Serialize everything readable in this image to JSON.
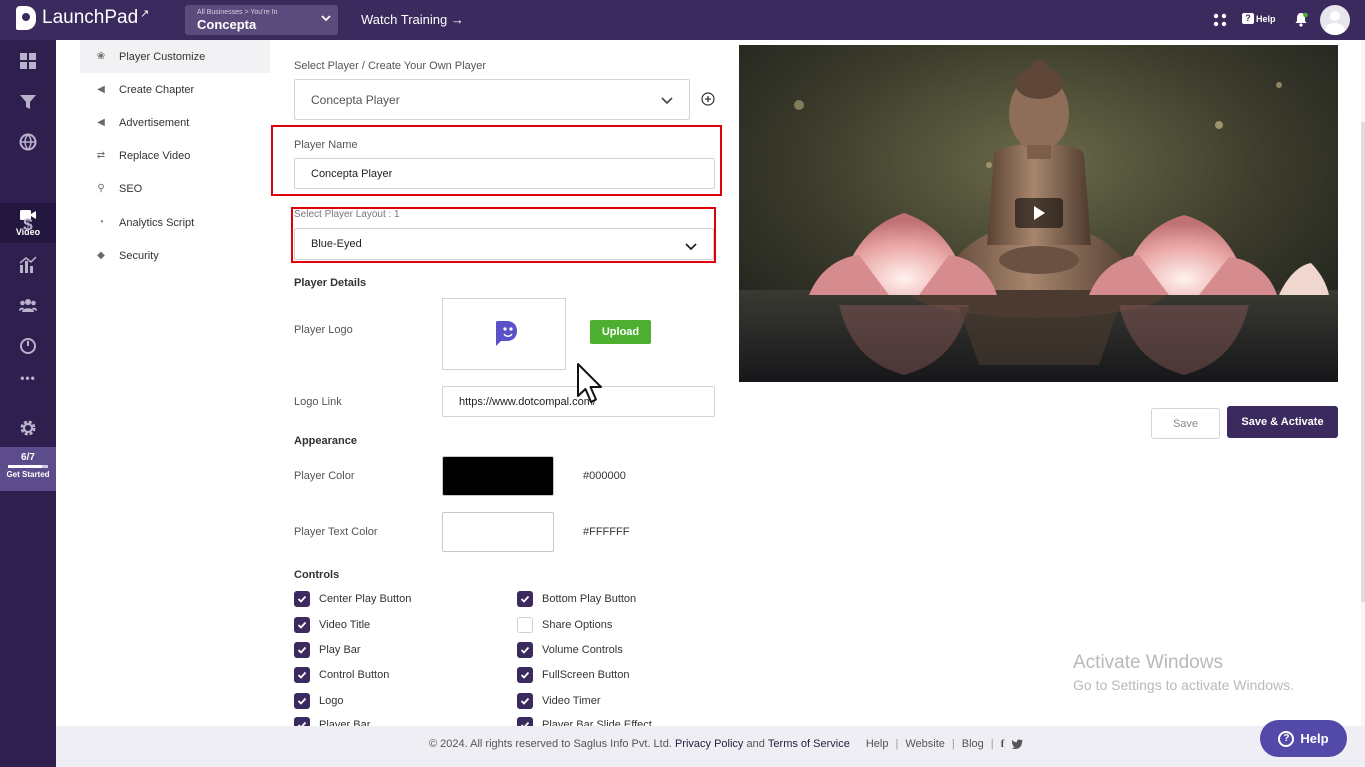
{
  "topbar": {
    "brand": "LaunchPad",
    "business_caption": "All Businesses > You're In",
    "business_name": "Concepta",
    "watch_training": "Watch Training →",
    "help_label": "Help",
    "help_glyph": "?",
    "bg_color": "#3b2a5e"
  },
  "rail": {
    "active_label": "Video",
    "progress_count": "6/7",
    "progress_fraction": 0.857,
    "get_started": "Get Started",
    "more_glyph": "•••"
  },
  "submenu": {
    "items": [
      {
        "label": "Player Customize",
        "icon": "palette-icon"
      },
      {
        "label": "Create Chapter",
        "icon": "megaphone-icon"
      },
      {
        "label": "Advertisement",
        "icon": "megaphone-icon"
      },
      {
        "label": "Replace Video",
        "icon": "swap-icon"
      },
      {
        "label": "SEO",
        "icon": "search-icon"
      },
      {
        "label": "Analytics Script",
        "icon": "chart-icon"
      },
      {
        "label": "Security",
        "icon": "shield-icon"
      }
    ]
  },
  "form": {
    "select_player_label": "Select Player / Create Your Own Player",
    "select_player_value": "Concepta Player",
    "player_name_label": "Player Name",
    "player_name_value": "Concepta Player",
    "layout_label": "Select Player Layout : 1",
    "layout_value": "Blue-Eyed",
    "player_details": "Player Details",
    "player_logo_label": "Player Logo",
    "upload_label": "Upload",
    "logo_link_label": "Logo Link",
    "logo_link_value": "https://www.dotcompal.com/",
    "appearance": "Appearance",
    "player_color_label": "Player Color",
    "player_color_value": "#000000",
    "player_text_color_label": "Player Text Color",
    "player_text_color_value": "#FFFFFF",
    "controls_label": "Controls",
    "controls_left": [
      {
        "label": "Center Play Button",
        "checked": true
      },
      {
        "label": "Video Title",
        "checked": true
      },
      {
        "label": "Play Bar",
        "checked": true
      },
      {
        "label": "Control Button",
        "checked": true
      },
      {
        "label": "Logo",
        "checked": true
      },
      {
        "label": "Player Bar",
        "checked": true
      }
    ],
    "controls_right": [
      {
        "label": "Bottom Play Button",
        "checked": true
      },
      {
        "label": "Share Options",
        "checked": false
      },
      {
        "label": "Volume Controls",
        "checked": true
      },
      {
        "label": "FullScreen Button",
        "checked": true
      },
      {
        "label": "Video Timer",
        "checked": true
      },
      {
        "label": "Player Bar Slide Effect",
        "checked": true
      }
    ]
  },
  "actions": {
    "save": "Save",
    "save_activate": "Save & Activate"
  },
  "watermark": {
    "line1": "Activate Windows",
    "line2": "Go to Settings to activate Windows."
  },
  "footer": {
    "copyright": "©  2024. All rights reserved to Saglus Info Pvt. Ltd.",
    "privacy": "Privacy Policy",
    "and": "and",
    "terms": "Terms of Service",
    "help": "Help",
    "website": "Website",
    "blog": "Blog",
    "sep": "|",
    "facebook_glyph": "f"
  },
  "help_fab": {
    "label": "Help",
    "glyph": "?"
  }
}
